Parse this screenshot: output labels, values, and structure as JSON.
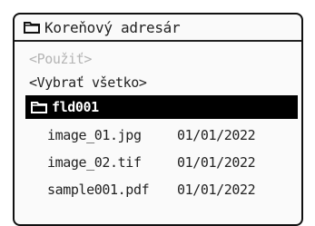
{
  "header": {
    "icon": "folder-icon",
    "title": "Koreňový adresár"
  },
  "actions": {
    "use_label": "<Použiť>",
    "use_enabled": false,
    "select_all_label": "<Vybrať všetko>"
  },
  "folder": {
    "icon": "folder-icon",
    "name": "fld001",
    "selected": true
  },
  "files": [
    {
      "name": "image_01.jpg",
      "date": "01/01/2022"
    },
    {
      "name": "image_02.tif",
      "date": "01/01/2022"
    },
    {
      "name": "sample001.pdf",
      "date": "01/01/2022"
    }
  ],
  "colors": {
    "selection_bg": "#000000",
    "selection_fg": "#ffffff",
    "disabled_text": "#b4b4b4"
  }
}
